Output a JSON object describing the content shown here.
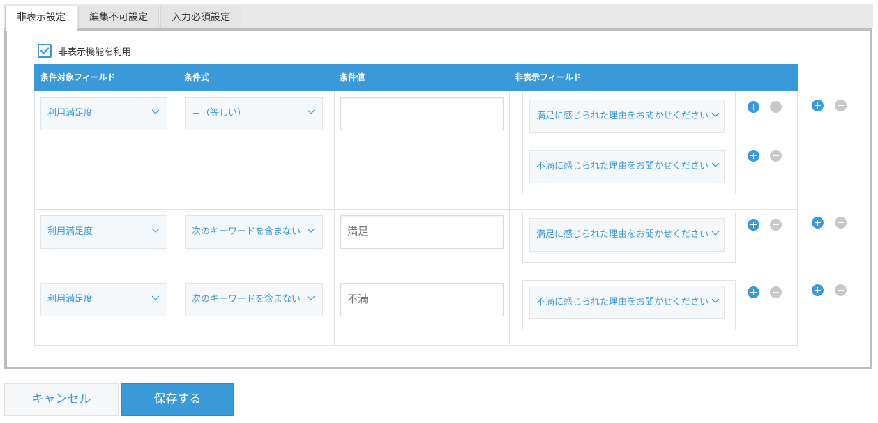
{
  "tabs": [
    "非表示設定",
    "編集不可設定",
    "入力必須設定"
  ],
  "checkbox": {
    "label": "非表示機能を利用",
    "checked": true
  },
  "table": {
    "headers": [
      "条件対象フィールド",
      "条件式",
      "条件値",
      "非表示フィールド"
    ],
    "rows": [
      {
        "field": "利用満足度",
        "operator": "＝（等しい）",
        "value": "",
        "hidden_fields": [
          "満足に感じられた理由をお聞かせください",
          "不満に感じられた理由をお聞かせください"
        ]
      },
      {
        "field": "利用満足度",
        "operator": "次のキーワードを含まない",
        "value": "満足",
        "hidden_fields": [
          "満足に感じられた理由をお聞かせください"
        ]
      },
      {
        "field": "利用満足度",
        "operator": "次のキーワードを含まない",
        "value": "不満",
        "hidden_fields": [
          "不満に感じられた理由をお聞かせください"
        ]
      }
    ]
  },
  "buttons": {
    "cancel": "キャンセル",
    "save": "保存する"
  },
  "colors": {
    "accent": "#3a9ad9",
    "remove": "#c8c8c8",
    "frame": "#bdbdbd"
  },
  "icons": {
    "dropdown": "chevron-down-icon",
    "check": "check-icon",
    "add": "plus-circle-icon",
    "remove": "minus-circle-icon"
  }
}
